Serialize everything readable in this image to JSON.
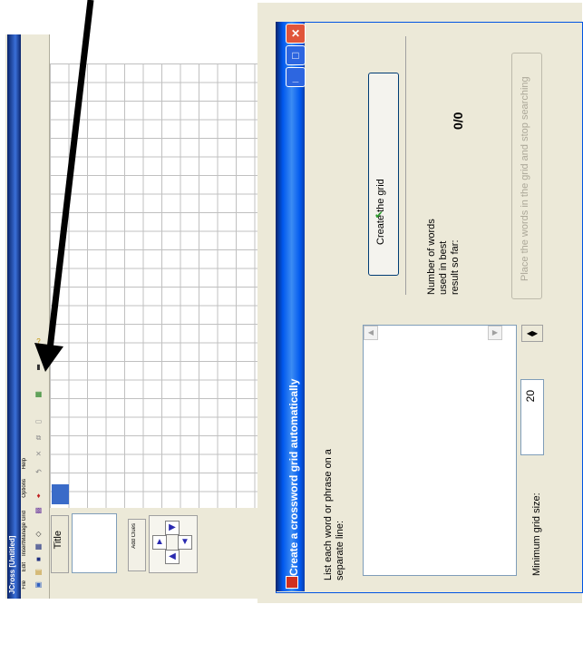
{
  "app": {
    "title": "JCross [Untitled]",
    "menus": [
      "File",
      "Edit",
      "Insert",
      "Manage Grid",
      "Options",
      "Help"
    ],
    "title_box_label": "Title",
    "add_clues_label": "Add Clues",
    "selected_cell_color": "#3a6bc8"
  },
  "dialog": {
    "title": "Create a crossword grid automatically",
    "instructions": [
      "List each word or phrase on a",
      "separate line:"
    ],
    "min_size_label": "Minimum grid size:",
    "min_size_value": "20",
    "create_grid_label": "Create the grid",
    "num_clues_label": [
      "Number of words",
      "used in best",
      "result so far:"
    ],
    "clue_count": "0/0",
    "disabled_button_label": "Place the words in the grid and stop searching",
    "accent_color": "#0058ee"
  }
}
